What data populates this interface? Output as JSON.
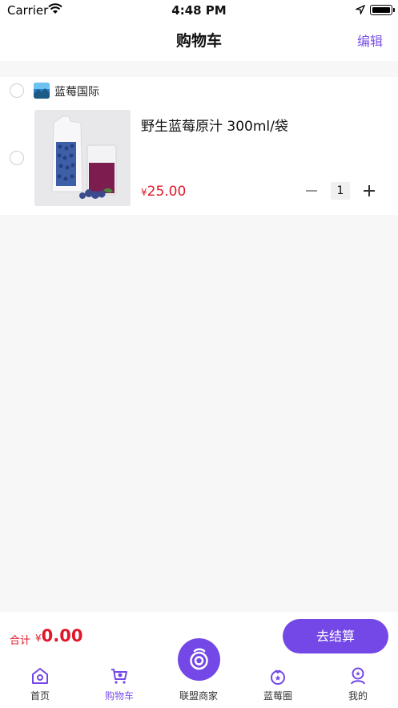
{
  "status_bar": {
    "carrier": "Carrier",
    "time": "4:48 PM"
  },
  "nav": {
    "title": "购物车",
    "edit_label": "编辑"
  },
  "shop": {
    "name": "蓝莓国际"
  },
  "cart_item": {
    "title": "野生蓝莓原汁 300ml/袋",
    "currency": "¥",
    "price": "25.00",
    "quantity": "1"
  },
  "total": {
    "label": "合计",
    "currency": "¥",
    "value": "0.00",
    "checkout_label": "去结算"
  },
  "tabs": [
    {
      "label": "首页",
      "icon": "home-icon"
    },
    {
      "label": "购物车",
      "icon": "cart-icon"
    },
    {
      "label": "联盟商家",
      "icon": "alliance-icon"
    },
    {
      "label": "蓝莓圈",
      "icon": "blueberry-icon"
    },
    {
      "label": "我的",
      "icon": "profile-icon"
    }
  ],
  "colors": {
    "accent": "#7348e6",
    "price": "#e0172a",
    "background": "#f7f7f7"
  }
}
